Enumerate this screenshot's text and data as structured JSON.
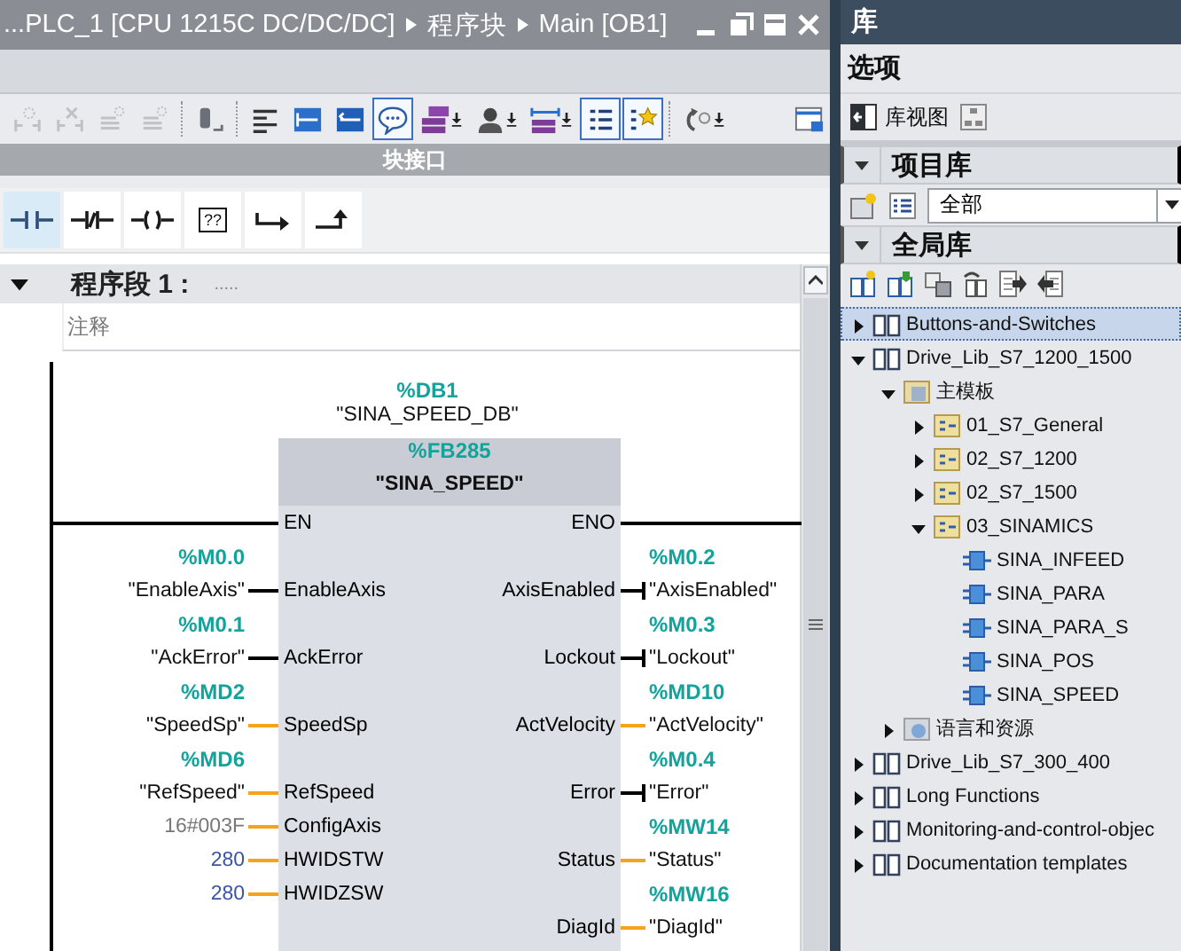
{
  "editor": {
    "breadcrumb": [
      "...PLC_1 [CPU 1215C DC/DC/DC]",
      "程序块",
      "Main [OB1]"
    ],
    "toolbar": [
      {
        "on": false,
        "disabled": true
      },
      {
        "on": false,
        "disabled": true
      },
      {
        "on": false,
        "disabled": true
      },
      {
        "on": false,
        "disabled": true
      },
      {
        "on": false,
        "disabled": false
      },
      {
        "on": false,
        "disabled": false
      },
      {
        "on": false,
        "disabled": false
      },
      {
        "on": false,
        "disabled": false
      },
      {
        "on": true,
        "disabled": false
      },
      {
        "on": false,
        "disabled": false
      },
      {
        "on": false,
        "disabled": false
      },
      {
        "on": false,
        "disabled": false
      },
      {
        "on": true,
        "disabled": false
      },
      {
        "on": true,
        "disabled": false
      },
      {
        "on": false,
        "disabled": false
      },
      {
        "on": false,
        "disabled": false
      }
    ],
    "interface_bar": "块接口",
    "instructions": [
      {
        "kind": "contact_no",
        "selected": true
      },
      {
        "kind": "contact_nc",
        "selected": false
      },
      {
        "kind": "coil",
        "selected": false
      },
      {
        "kind": "empty_box",
        "text": "??",
        "selected": false
      },
      {
        "kind": "jump",
        "selected": false
      },
      {
        "kind": "open_branch",
        "selected": false
      }
    ],
    "network": {
      "title": "程序段 1 :",
      "title_comment": ".....",
      "comment_placeholder": "注释",
      "expanded": true,
      "block": {
        "instance_address": "%DB1",
        "instance_name": "\"SINA_SPEED_DB\"",
        "address": "%FB285",
        "name": "\"SINA_SPEED\"",
        "en": "EN",
        "eno": "ENO",
        "inputs": [
          {
            "pin": "EnableAxis",
            "address": "%M0.0",
            "operand": "\"EnableAxis\"",
            "kind": "bool"
          },
          {
            "pin": "AckError",
            "address": "%M0.1",
            "operand": "\"AckError\"",
            "kind": "bool"
          },
          {
            "pin": "SpeedSp",
            "address": "%MD2",
            "operand": "\"SpeedSp\"",
            "kind": "data"
          },
          {
            "pin": "RefSpeed",
            "address": "%MD6",
            "operand": "\"RefSpeed\"",
            "kind": "data"
          },
          {
            "pin": "ConfigAxis",
            "operand": "16#003F",
            "kind": "hex_constant"
          },
          {
            "pin": "HWIDSTW",
            "operand": "280",
            "kind": "int_constant"
          },
          {
            "pin": "HWIDZSW",
            "operand": "280",
            "kind": "int_constant"
          }
        ],
        "outputs": [
          {
            "pin": "AxisEnabled",
            "address": "%M0.2",
            "operand": "\"AxisEnabled\"",
            "kind": "bool"
          },
          {
            "pin": "Lockout",
            "address": "%M0.3",
            "operand": "\"Lockout\"",
            "kind": "bool"
          },
          {
            "pin": "ActVelocity",
            "address": "%MD10",
            "operand": "\"ActVelocity\"",
            "kind": "data"
          },
          {
            "pin": "Error",
            "address": "%M0.4",
            "operand": "\"Error\"",
            "kind": "bool"
          },
          {
            "pin": "Status",
            "address": "%MW14",
            "operand": "\"Status\"",
            "kind": "data"
          },
          {
            "pin": "DiagId",
            "address": "%MW16",
            "operand": "\"DiagId\"",
            "kind": "data"
          }
        ]
      }
    }
  },
  "library": {
    "title": "库",
    "options_label": "选项",
    "view_button": "库视图",
    "project_library": {
      "title": "项目库",
      "expanded": true,
      "filter": "全部"
    },
    "global_library": {
      "title": "全局库",
      "expanded": true,
      "items": [
        {
          "label": "Buttons-and-Switches",
          "kind": "library",
          "expanded": false,
          "selected": true
        },
        {
          "label": "Drive_Lib_S7_1200_1500",
          "kind": "library",
          "expanded": true,
          "selected": false,
          "children": [
            {
              "label": "主模板",
              "kind": "master_folder",
              "expanded": true,
              "selected": false,
              "children": [
                {
                  "label": "01_S7_General",
                  "kind": "type_folder",
                  "expanded": false,
                  "selected": false
                },
                {
                  "label": "02_S7_1200",
                  "kind": "type_folder",
                  "expanded": false,
                  "selected": false
                },
                {
                  "label": "02_S7_1500",
                  "kind": "type_folder",
                  "expanded": false,
                  "selected": false
                },
                {
                  "label": "03_SINAMICS",
                  "kind": "type_folder",
                  "expanded": true,
                  "selected": false,
                  "children": [
                    {
                      "label": "SINA_INFEED",
                      "kind": "block",
                      "selected": false
                    },
                    {
                      "label": "SINA_PARA",
                      "kind": "block",
                      "selected": false
                    },
                    {
                      "label": "SINA_PARA_S",
                      "kind": "block",
                      "selected": false
                    },
                    {
                      "label": "SINA_POS",
                      "kind": "block",
                      "selected": false
                    },
                    {
                      "label": "SINA_SPEED",
                      "kind": "block",
                      "selected": false
                    }
                  ]
                }
              ]
            },
            {
              "label": "语言和资源",
              "kind": "resource_folder",
              "expanded": false,
              "selected": false
            }
          ]
        },
        {
          "label": "Drive_Lib_S7_300_400",
          "kind": "library",
          "expanded": false,
          "selected": false
        },
        {
          "label": "Long Functions",
          "kind": "library",
          "expanded": false,
          "selected": false
        },
        {
          "label": "Monitoring-and-control-objec",
          "kind": "library",
          "expanded": false,
          "selected": false
        },
        {
          "label": "Documentation templates",
          "kind": "library",
          "expanded": false,
          "selected": false
        }
      ]
    }
  }
}
